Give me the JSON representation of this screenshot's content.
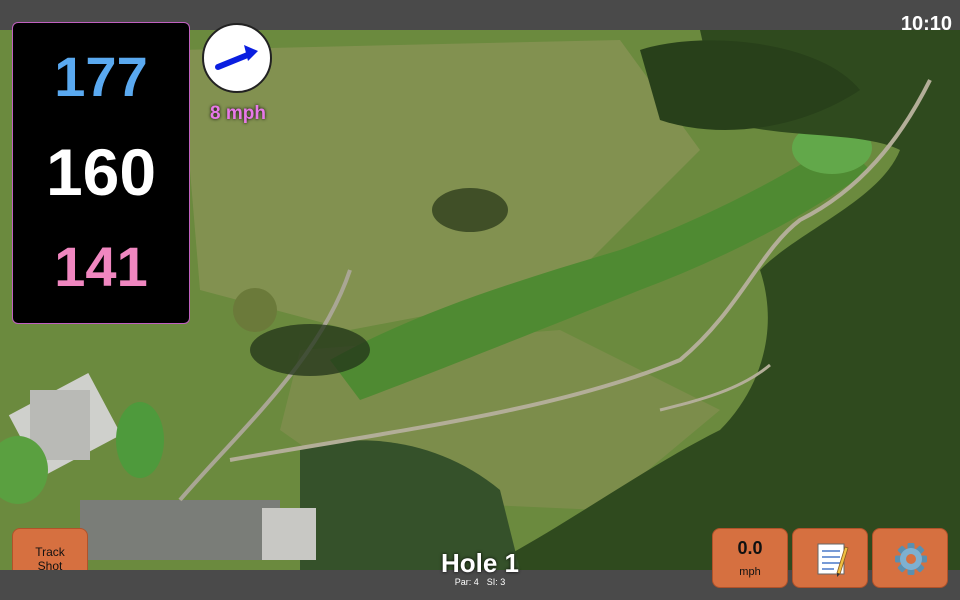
{
  "status_bar": {
    "time": "10:10"
  },
  "yardage": {
    "back": "177",
    "middle": "160",
    "front": "141"
  },
  "wind": {
    "speed_label": "8 mph",
    "direction_icon": "arrow-right-icon",
    "arrow_color": "#0a1ee0"
  },
  "buttons": {
    "track_shot_line1": "Track",
    "track_shot_line2": "Shot",
    "speed_value": "0.0",
    "speed_unit": "mph",
    "notes_icon": "notepad-icon",
    "settings_icon": "gear-icon"
  },
  "hole": {
    "title": "Hole 1",
    "par_label": "Par: 4",
    "si_label": "SI: 3"
  },
  "colors": {
    "back_yardage": "#5aa9f0",
    "middle_yardage": "#ffffff",
    "front_yardage": "#f087c0",
    "button_bg": "#d67040",
    "bar_bg": "#4a4a4a"
  }
}
